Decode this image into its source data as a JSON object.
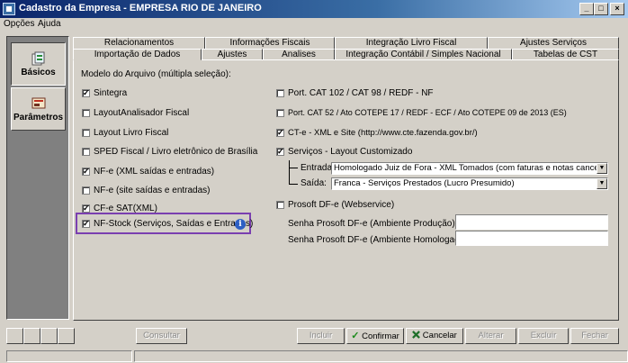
{
  "window": {
    "title": "Cadastro da Empresa - EMPRESA RIO DE JANEIRO",
    "min_label": "_",
    "max_label": "□",
    "close_label": "×"
  },
  "menu": [
    "Opções",
    "Ajuda"
  ],
  "sidebar": [
    {
      "label": "Básicos",
      "icon": "documents-icon",
      "active": true
    },
    {
      "label": "Parâmetros",
      "icon": "settings-panel-icon",
      "active": false
    }
  ],
  "tabs_row1": [
    "Relacionamentos",
    "Informações Fiscais",
    "Integração Livro Fiscal",
    "Ajustes Serviços"
  ],
  "tabs_row2": [
    "Importação de Dados",
    "Ajustes",
    "Analises",
    "Integração Contábil / Simples Nacional",
    "Tabelas de CST"
  ],
  "section_label": "Modelo do Arquivo (múltipla seleção):",
  "left_options": [
    {
      "label": "Sintegra",
      "checked": true
    },
    {
      "label": "LayoutAnalisador Fiscal",
      "checked": false
    },
    {
      "label": "Layout Livro Fiscal",
      "checked": false
    },
    {
      "label": "SPED Fiscal / Livro eletrônico de Brasília",
      "checked": false
    },
    {
      "label": "NF-e (XML saídas e entradas)",
      "checked": true
    },
    {
      "label": "NF-e (site saídas e entradas)",
      "checked": false
    },
    {
      "label": "CF-e SAT(XML)",
      "checked": true
    },
    {
      "label": "NF-Stock (Serviços, Saídas e Entradas)",
      "checked": true
    }
  ],
  "right_options": [
    {
      "label": "Port. CAT 102 / CAT 98 / REDF - NF",
      "checked": false
    },
    {
      "label": "Port. CAT 52 / Ato COTEPE 17 / REDF - ECF / Ato COTEPE 09 de 2013 (ES)",
      "checked": false
    },
    {
      "label": "CT-e - XML e Site (http://www.cte.fazenda.gov.br/)",
      "checked": true
    },
    {
      "label": "Serviços - Layout Customizado",
      "checked": true
    },
    {
      "label": "Prosoft DF-e (Webservice)",
      "checked": false
    }
  ],
  "entrada": {
    "label": "Entrada:",
    "value": "Homologado Juiz de Fora - XML Tomados (com faturas e notas canceladas - "
  },
  "saida": {
    "label": "Saída:",
    "value": "Franca - Serviços Prestados (Lucro Presumido)"
  },
  "senha_producao": {
    "label": "Senha Prosoft DF-e (Ambiente Produção):",
    "value": ""
  },
  "senha_homologacao": {
    "label": "Senha Prosoft DF-e (Ambiente Homologação):",
    "value": ""
  },
  "info_icon_glyph": "i",
  "check_glyph": "✓",
  "select_arrow": "▼",
  "buttons": {
    "consultar": "Consultar",
    "incluir": "Incluir",
    "confirmar": "Confirmar",
    "cancelar": "Cancelar",
    "alterar": "Alterar",
    "excluir": "Excluir",
    "fechar": "Fechar"
  },
  "colors": {
    "titlebar": "#0a246a",
    "highlight_border": "#7a3fb0",
    "face": "#d4d0c8"
  }
}
